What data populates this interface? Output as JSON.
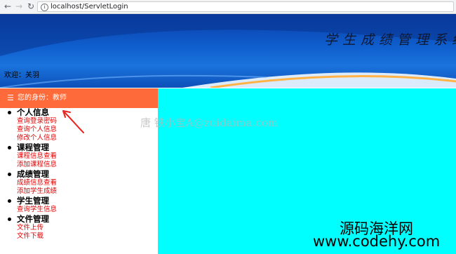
{
  "browser": {
    "url": "localhost/ServletLogin",
    "back_icon": "arrow-left-icon",
    "forward_icon": "arrow-right-icon",
    "reload_icon": "reload-icon",
    "info_icon": "info-icon"
  },
  "banner": {
    "title": "学生成绩管理系统",
    "welcome": "欢迎：关羽"
  },
  "sidebar": {
    "menu_icon": "hamburger-icon",
    "identity": "您的身份：教师",
    "groups": [
      {
        "title": "个人信息",
        "links": [
          "查询登录密码",
          "查询个人信息",
          "修改个人信息"
        ]
      },
      {
        "title": "课程管理",
        "links": [
          "课程信息查看",
          "添加课程信息"
        ]
      },
      {
        "title": "成绩管理",
        "links": [
          "成绩信息查看",
          "添加学生成绩"
        ]
      },
      {
        "title": "学生管理",
        "links": [
          "查询学生信息"
        ]
      },
      {
        "title": "文件管理",
        "links": [
          "文件上传",
          "文件下载"
        ]
      }
    ]
  },
  "watermarks": {
    "center": "唐 铁小宝A@zuidaima.com",
    "brand": "源码海洋网",
    "url": "www.codehy.com"
  },
  "colors": {
    "identity_bar": "#ff6a3a",
    "content_bg": "#00ffff",
    "link": "#e30000"
  }
}
